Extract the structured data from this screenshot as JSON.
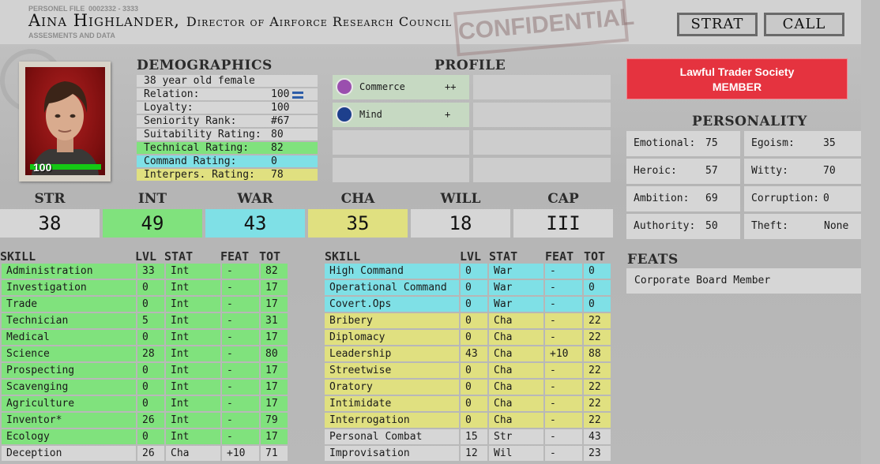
{
  "header": {
    "file_label": "PERSONEL FILE",
    "file_number": "0002332 - 3333",
    "sub_label": "ASSESMENTS AND DATA",
    "name": "Aina Highlander,",
    "role": "Director of Airforce Research Council",
    "stamp": "CONFIDENTIAL",
    "strat_label": "STRAT",
    "call_label": "CALL"
  },
  "portrait": {
    "health": "100"
  },
  "demographics": {
    "title": "DEMOGRAPHICS",
    "summary": "38 year old female",
    "rows": [
      {
        "label": "Relation:",
        "value": "100"
      },
      {
        "label": "Loyalty:",
        "value": "100"
      },
      {
        "label": "Seniority Rank:",
        "value": "#67"
      },
      {
        "label": "Suitability Rating:",
        "value": "80"
      },
      {
        "label": "Technical Rating:",
        "value": "82"
      },
      {
        "label": "Command Rating:",
        "value": "0"
      },
      {
        "label": "Interpers. Rating:",
        "value": "78"
      }
    ]
  },
  "profile": {
    "title": "PROFILE",
    "traits": [
      {
        "name": "Commerce",
        "level": "++",
        "icon": "coins-icon"
      },
      {
        "name": "Mind",
        "level": "+",
        "icon": "graduation-cap-icon"
      }
    ]
  },
  "stats": [
    {
      "name": "STR",
      "value": "38"
    },
    {
      "name": "INT",
      "value": "49"
    },
    {
      "name": "WAR",
      "value": "43"
    },
    {
      "name": "CHA",
      "value": "35"
    },
    {
      "name": "WILL",
      "value": "18"
    },
    {
      "name": "CAP",
      "value": "III"
    }
  ],
  "skill_headers": {
    "skill": "SKILL",
    "lvl": "LVL",
    "stat": "STAT",
    "feat": "FEAT",
    "tot": "TOT"
  },
  "skills_left": [
    {
      "name": "Administration",
      "lvl": "33",
      "stat": "Int",
      "feat": "-",
      "tot": "82"
    },
    {
      "name": "Investigation",
      "lvl": "0",
      "stat": "Int",
      "feat": "-",
      "tot": "17"
    },
    {
      "name": "Trade",
      "lvl": "0",
      "stat": "Int",
      "feat": "-",
      "tot": "17"
    },
    {
      "name": "Technician",
      "lvl": "5",
      "stat": "Int",
      "feat": "-",
      "tot": "31"
    },
    {
      "name": "Medical",
      "lvl": "0",
      "stat": "Int",
      "feat": "-",
      "tot": "17"
    },
    {
      "name": "Science",
      "lvl": "28",
      "stat": "Int",
      "feat": "-",
      "tot": "80"
    },
    {
      "name": "Prospecting",
      "lvl": "0",
      "stat": "Int",
      "feat": "-",
      "tot": "17"
    },
    {
      "name": "Scavenging",
      "lvl": "0",
      "stat": "Int",
      "feat": "-",
      "tot": "17"
    },
    {
      "name": "Agriculture",
      "lvl": "0",
      "stat": "Int",
      "feat": "-",
      "tot": "17"
    },
    {
      "name": "Inventor*",
      "lvl": "26",
      "stat": "Int",
      "feat": "-",
      "tot": "79"
    },
    {
      "name": "Ecology",
      "lvl": "0",
      "stat": "Int",
      "feat": "-",
      "tot": "17"
    },
    {
      "name": "Deception",
      "lvl": "26",
      "stat": "Cha",
      "feat": "+10",
      "tot": "71"
    }
  ],
  "skills_right": [
    {
      "name": "High Command",
      "lvl": "0",
      "stat": "War",
      "feat": "-",
      "tot": "0"
    },
    {
      "name": "Operational Command",
      "lvl": "0",
      "stat": "War",
      "feat": "-",
      "tot": "0"
    },
    {
      "name": "Covert.Ops",
      "lvl": "0",
      "stat": "War",
      "feat": "-",
      "tot": "0"
    },
    {
      "name": "Bribery",
      "lvl": "0",
      "stat": "Cha",
      "feat": "-",
      "tot": "22"
    },
    {
      "name": "Diplomacy",
      "lvl": "0",
      "stat": "Cha",
      "feat": "-",
      "tot": "22"
    },
    {
      "name": "Leadership",
      "lvl": "43",
      "stat": "Cha",
      "feat": "+10",
      "tot": "88"
    },
    {
      "name": "Streetwise",
      "lvl": "0",
      "stat": "Cha",
      "feat": "-",
      "tot": "22"
    },
    {
      "name": "Oratory",
      "lvl": "0",
      "stat": "Cha",
      "feat": "-",
      "tot": "22"
    },
    {
      "name": "Intimidate",
      "lvl": "0",
      "stat": "Cha",
      "feat": "-",
      "tot": "22"
    },
    {
      "name": "Interrogation",
      "lvl": "0",
      "stat": "Cha",
      "feat": "-",
      "tot": "22"
    },
    {
      "name": "Personal Combat",
      "lvl": "15",
      "stat": "Str",
      "feat": "-",
      "tot": "43"
    },
    {
      "name": "Improvisation",
      "lvl": "12",
      "stat": "Wil",
      "feat": "-",
      "tot": "23"
    }
  ],
  "faction": {
    "name": "Lawful Trader Society",
    "rank": "MEMBER"
  },
  "personality": {
    "title": "PERSONALITY",
    "rows": [
      {
        "label": "Emotional:",
        "value": "75"
      },
      {
        "label": "Egoism:",
        "value": "35"
      },
      {
        "label": "Heroic:",
        "value": "57"
      },
      {
        "label": "Witty:",
        "value": "70"
      },
      {
        "label": "Ambition:",
        "value": "69"
      },
      {
        "label": "Corruption:",
        "value": "0"
      },
      {
        "label": "Authority:",
        "value": "50"
      },
      {
        "label": "Theft:",
        "value": "None"
      }
    ]
  },
  "feats": {
    "title": "FEATS",
    "items": [
      "Corporate Board Member"
    ]
  },
  "colors": {
    "green": "#80e27d",
    "cyan": "#7fe0e6",
    "yellow": "#e0e080",
    "plain": "#d6d6d6",
    "faction_red": "#e5333f"
  }
}
